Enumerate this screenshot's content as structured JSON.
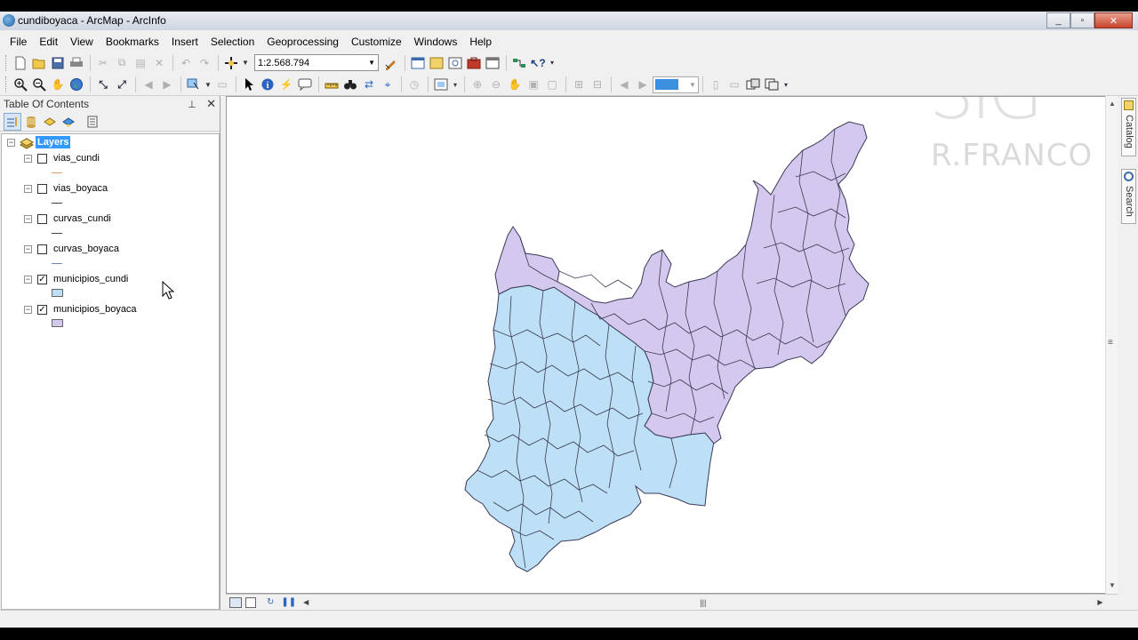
{
  "window": {
    "title": "cundiboyaca - ArcMap - ArcInfo",
    "controls": [
      "_",
      "▫",
      "✕"
    ]
  },
  "menu": [
    "File",
    "Edit",
    "View",
    "Bookmarks",
    "Insert",
    "Selection",
    "Geoprocessing",
    "Customize",
    "Windows",
    "Help"
  ],
  "toolbar": {
    "scale": "1:2.568.794"
  },
  "toc": {
    "title": "Table Of Contents",
    "root_label": "Layers",
    "layers": [
      {
        "name": "vias_cundi",
        "checked": false,
        "symbol": "line",
        "color": "#d4a06a"
      },
      {
        "name": "vias_boyaca",
        "checked": false,
        "symbol": "line",
        "color": "#444444"
      },
      {
        "name": "curvas_cundi",
        "checked": false,
        "symbol": "line",
        "color": "#444444"
      },
      {
        "name": "curvas_boyaca",
        "checked": false,
        "symbol": "line",
        "color": "#6f87b8"
      },
      {
        "name": "municipios_cundi",
        "checked": true,
        "symbol": "polygon",
        "color": "#bee0f7"
      },
      {
        "name": "municipios_boyaca",
        "checked": true,
        "symbol": "polygon",
        "color": "#d4c8ef"
      }
    ]
  },
  "side_tabs": {
    "catalog": "Catalog",
    "search": "Search"
  },
  "watermark": {
    "big": "SIG",
    "small": "R.FRANCO"
  },
  "map": {
    "cundi_fill": "#bee0f7",
    "boyaca_fill": "#d4c8ef",
    "outline": "#3a3a55"
  }
}
